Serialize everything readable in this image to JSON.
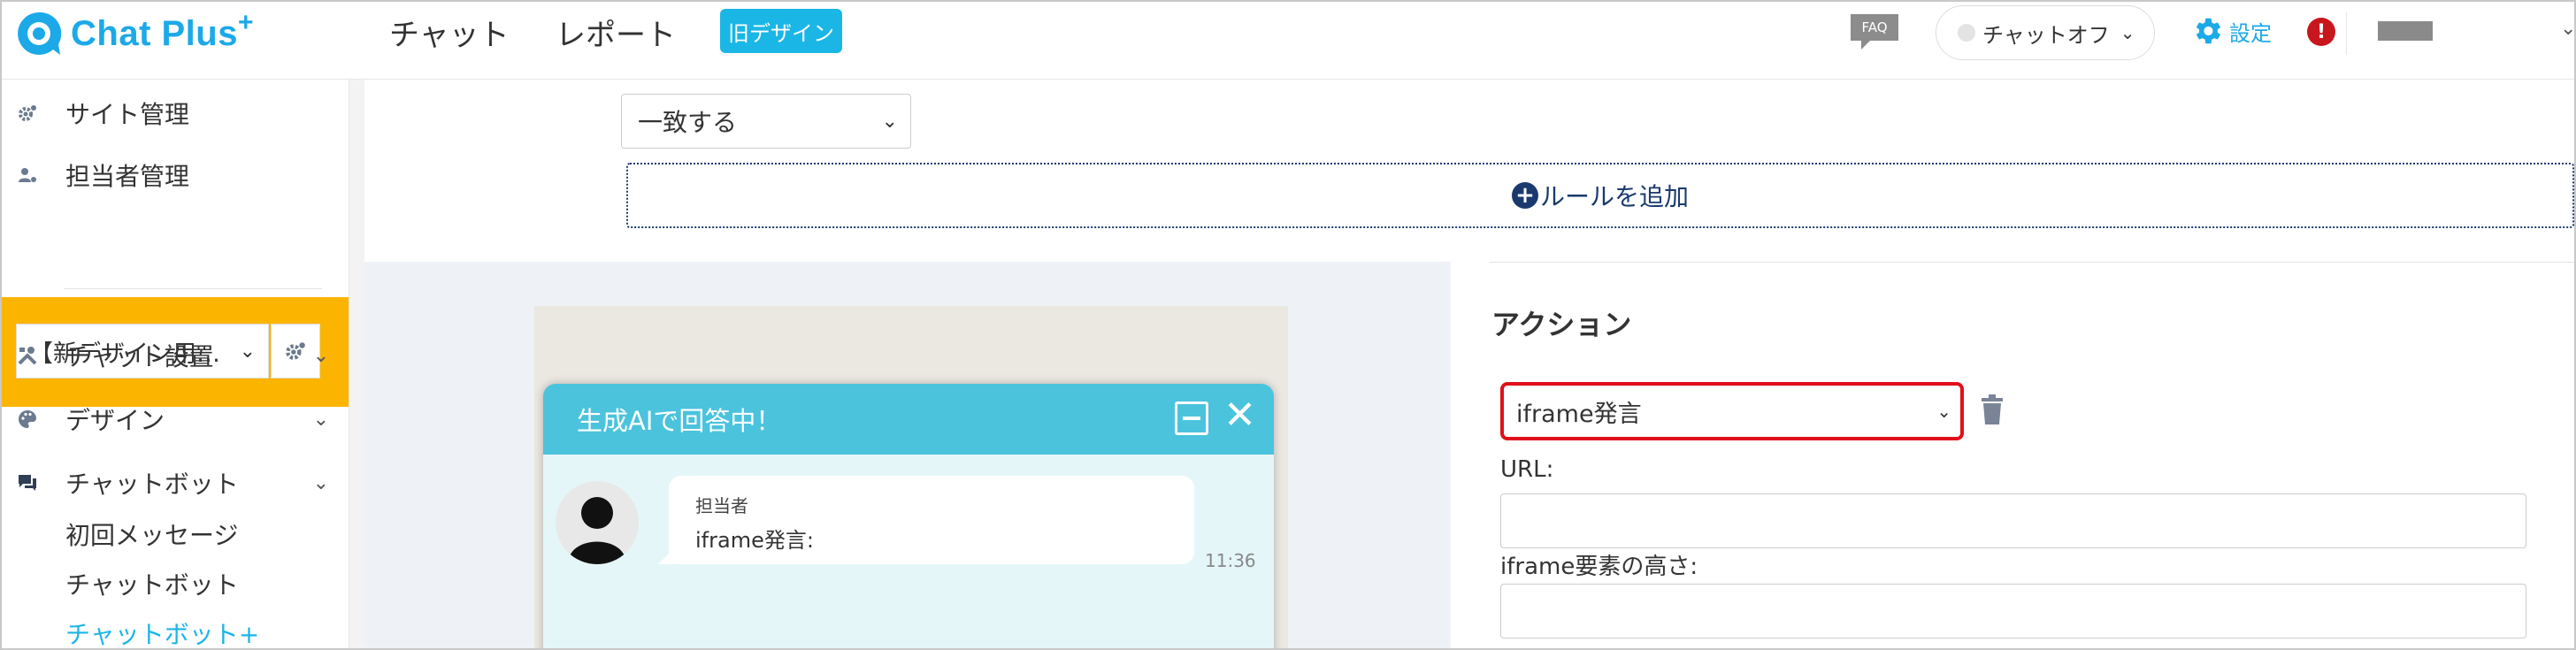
{
  "header": {
    "logo_text": "Chat Plus",
    "logo_plus": "+",
    "nav": [
      "チャット",
      "レポート"
    ],
    "old_design_label": "旧デザイン",
    "faq_label": "FAQ",
    "chat_status_label": "チャットオフ",
    "settings_label": "設定",
    "alert_label": "!"
  },
  "sidebar": {
    "site_management": "サイト管理",
    "staff_management": "担当者管理",
    "site_select_value": "【新デザイン用…",
    "chat_setup": "チャット設置",
    "design": "デザイン",
    "chatbot": "チャットボット",
    "sub_items": [
      "初回メッセージ",
      "チャットボット",
      "チャットボット+"
    ]
  },
  "rule": {
    "match_select_value": "一致する",
    "add_rule_label": "ルールを追加"
  },
  "preview": {
    "chat_title": "生成AIで回答中！",
    "agent_name": "担当者",
    "message": "iframe発言:",
    "time": "11:36"
  },
  "action": {
    "title": "アクション",
    "select_value": "iframe発言",
    "url_label": "URL:",
    "url_value": "",
    "height_label": "iframe要素の高さ:",
    "height_value": ""
  },
  "colors": {
    "brand": "#1ca9e8",
    "old_design_bg": "#1ab6e6",
    "site_box": "#fbb400",
    "chat_header": "#4bc3dd",
    "highlight_border": "#e0101a",
    "add_rule": "#1a3a6e"
  }
}
